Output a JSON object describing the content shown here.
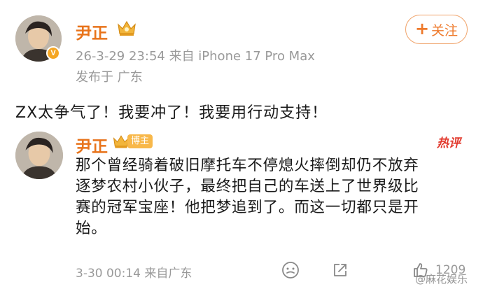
{
  "post": {
    "author": "尹正",
    "follow_label": "关注",
    "follow_plus": "+",
    "timestamp_source": "26-3-29 23:54  来自 iPhone 17 Pro Max",
    "location": "发布于 广东",
    "text": "ZX太争气了！我要冲了！我要用行动支持！"
  },
  "reply": {
    "author": "尹正",
    "role_tag": "博主",
    "hot_tag": "热评",
    "lines": [
      "那个曾经骑着破旧摩托车不停熄火摔倒却仍不放弃",
      "逐梦农村小伙子，最终把自己的车送上了世界级比",
      "赛的冠军宝座！他把梦追到了。而这一切都只是开",
      "始。"
    ],
    "meta": "3-30 00:14  来自广东",
    "like_count": "1209"
  },
  "watermark": "@麻花娱乐",
  "colors": {
    "author": "#e8731a",
    "follow": "#ee7a2c",
    "hot": "#e23a2e",
    "meta": "#999999"
  },
  "icons": [
    "avatar",
    "verified-badge-icon",
    "crown-badge-icon",
    "emoji-icon",
    "share-icon",
    "like-icon"
  ]
}
